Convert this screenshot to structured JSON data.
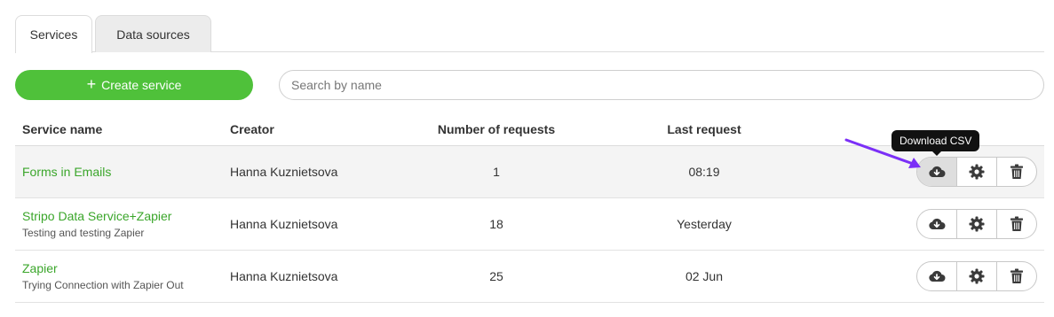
{
  "tabs": [
    {
      "label": "Services",
      "active": true
    },
    {
      "label": "Data sources",
      "active": false
    }
  ],
  "toolbar": {
    "create_label": "Create service",
    "search_placeholder": "Search by name"
  },
  "table": {
    "columns": [
      "Service name",
      "Creator",
      "Number of requests",
      "Last request"
    ],
    "rows": [
      {
        "name": "Forms in Emails",
        "description": "",
        "creator": "Hanna Kuznietsova",
        "requests": "1",
        "last_request": "08:19"
      },
      {
        "name": "Stripo Data Service+Zapier",
        "description": "Testing and testing Zapier",
        "creator": "Hanna Kuznietsova",
        "requests": "18",
        "last_request": "Yesterday"
      },
      {
        "name": "Zapier",
        "description": "Trying Connection with Zapier Out",
        "creator": "Hanna Kuznietsova",
        "requests": "25",
        "last_request": "02 Jun"
      }
    ]
  },
  "tooltip": {
    "text": "Download CSV"
  },
  "icons": [
    "plus-icon",
    "cloud-download-icon",
    "gear-icon",
    "trash-icon"
  ],
  "colors": {
    "accent_green": "#4fc13a",
    "link_green": "#3ba62b",
    "annotation_arrow": "#7b2ff7"
  }
}
